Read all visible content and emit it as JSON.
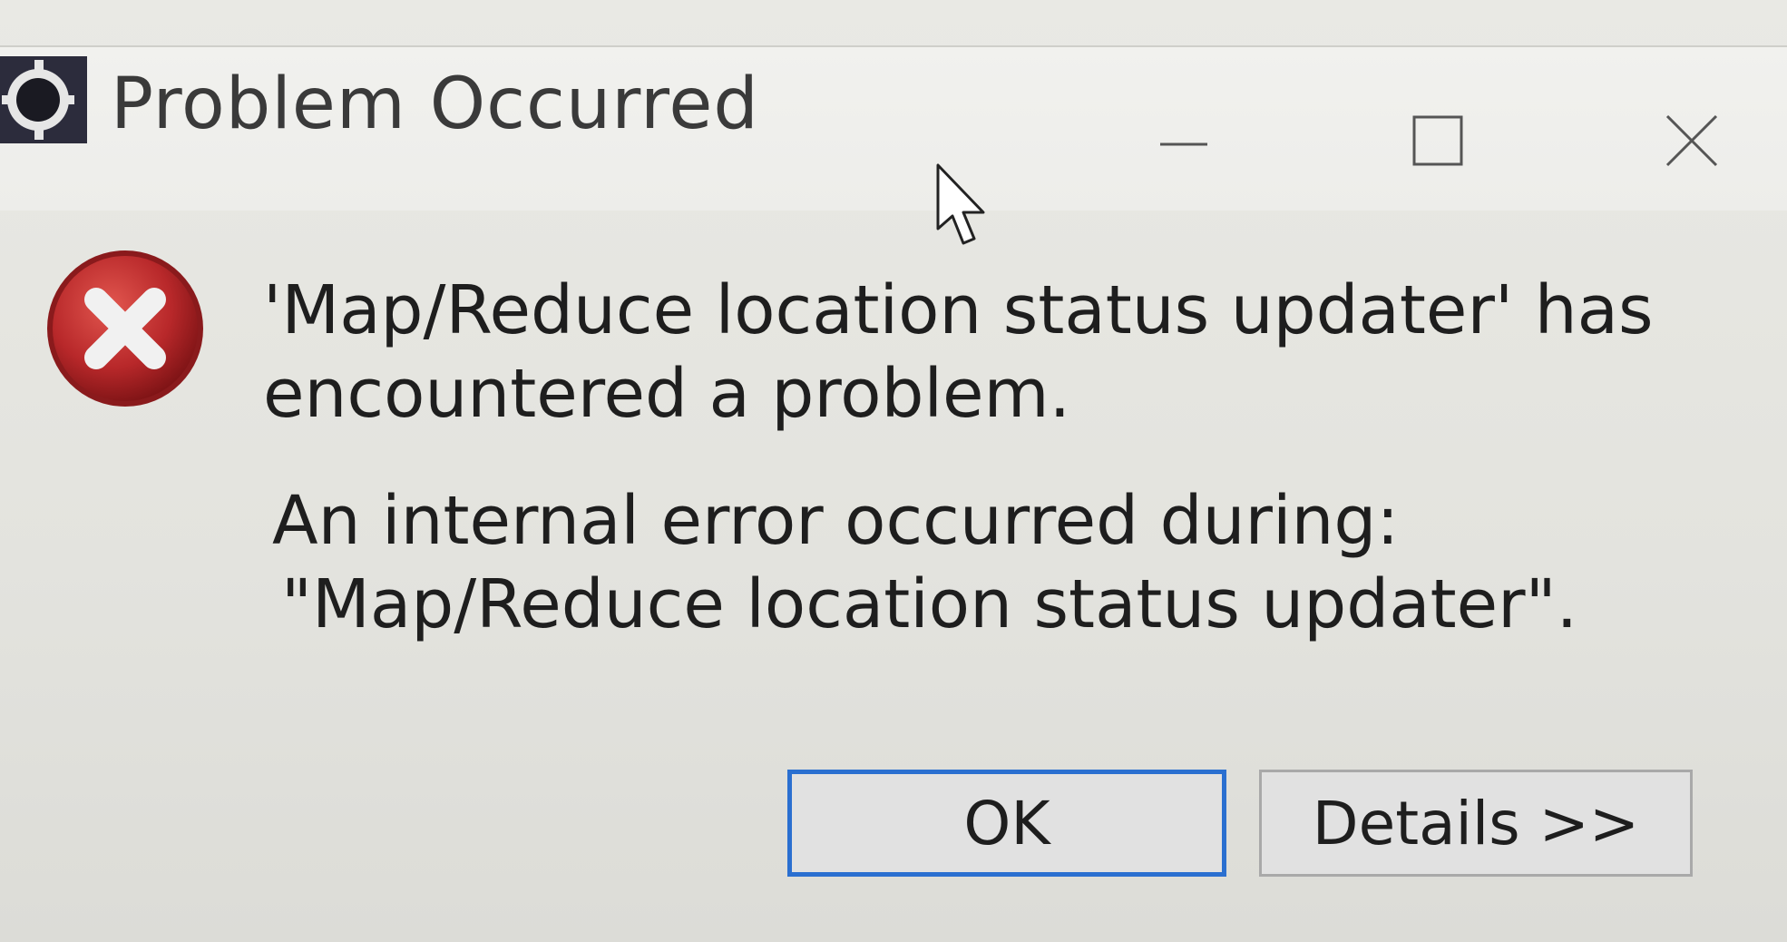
{
  "window": {
    "title": "Problem Occurred",
    "controls": {
      "minimize_icon": "minimize-icon",
      "maximize_icon": "maximize-icon",
      "close_icon": "close-icon"
    }
  },
  "message": {
    "line1": "'Map/Reduce location status updater' has",
    "line2": "encountered a problem.",
    "line3": "An internal error occurred during:",
    "line4": "\"Map/Reduce location status updater\"."
  },
  "buttons": {
    "ok_label": "OK",
    "details_label": "Details >>"
  },
  "icons": {
    "app": "app-gear-icon",
    "error": "error-icon",
    "cursor": "mouse-cursor-icon"
  },
  "colors": {
    "error_red": "#c0302c",
    "focus_blue": "#2a6fd0"
  }
}
